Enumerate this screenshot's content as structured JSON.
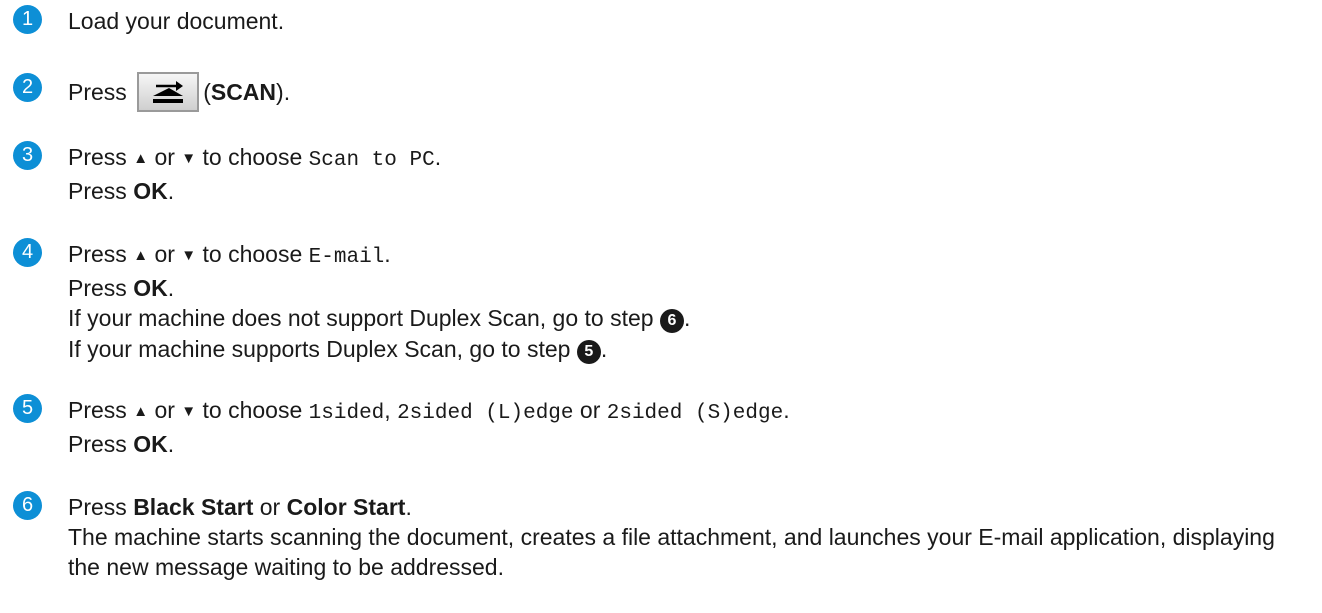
{
  "colors": {
    "step_circle": "#0d8fd6",
    "text": "#1a1a1a"
  },
  "steps": [
    {
      "num": "1",
      "text": "Load your document."
    },
    {
      "num": "2",
      "press": "Press",
      "icon": "scan-key-icon",
      "paren_open": "(",
      "scan": "SCAN",
      "paren_close": ")."
    },
    {
      "num": "3",
      "press": "Press",
      "up": "▲",
      "or": "or",
      "down": "▼",
      "to_choose": "to choose",
      "option": "Scan to PC",
      "period": ".",
      "press2": "Press",
      "ok": "OK",
      "ok_period": "."
    },
    {
      "num": "4",
      "press": "Press",
      "up": "▲",
      "or": "or",
      "down": "▼",
      "to_choose": "to choose",
      "option": "E-mail",
      "period": ".",
      "press2": "Press",
      "ok": "OK",
      "ok_period": ".",
      "line3": "If your machine does not support Duplex Scan, go to step",
      "line3_ref": "6",
      "line3_end": ".",
      "line4": "If your machine supports Duplex Scan, go to step",
      "line4_ref": "5",
      "line4_end": "."
    },
    {
      "num": "5",
      "press": "Press",
      "up": "▲",
      "or": "or",
      "down": "▼",
      "to_choose": "to choose",
      "opt1": "1sided",
      "comma": ",",
      "opt2": "2sided (L)edge",
      "or2": "or",
      "opt3": "2sided (S)edge",
      "period": ".",
      "press2": "Press",
      "ok": "OK",
      "ok_period": "."
    },
    {
      "num": "6",
      "press": "Press",
      "black": "Black Start",
      "or": "or",
      "color": "Color Start",
      "period": ".",
      "desc": "The machine starts scanning the document, creates a file attachment, and launches your E-mail application, displaying the new message waiting to be addressed."
    }
  ]
}
